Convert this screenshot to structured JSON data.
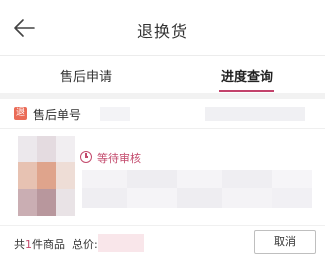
{
  "header": {
    "title": "退换货"
  },
  "tabs": [
    {
      "label": "售后申请"
    },
    {
      "label": "进度查询"
    }
  ],
  "order": {
    "badge": "退",
    "label": "售后单号"
  },
  "item": {
    "status": "等待审核"
  },
  "footer": {
    "summary_prefix": "共",
    "count": "1",
    "summary_suffix": "件商品",
    "total_label": "总价:",
    "cancel_label": "取消"
  },
  "colors": {
    "accent": "#c34a6c",
    "badge": "#ea6b57"
  }
}
